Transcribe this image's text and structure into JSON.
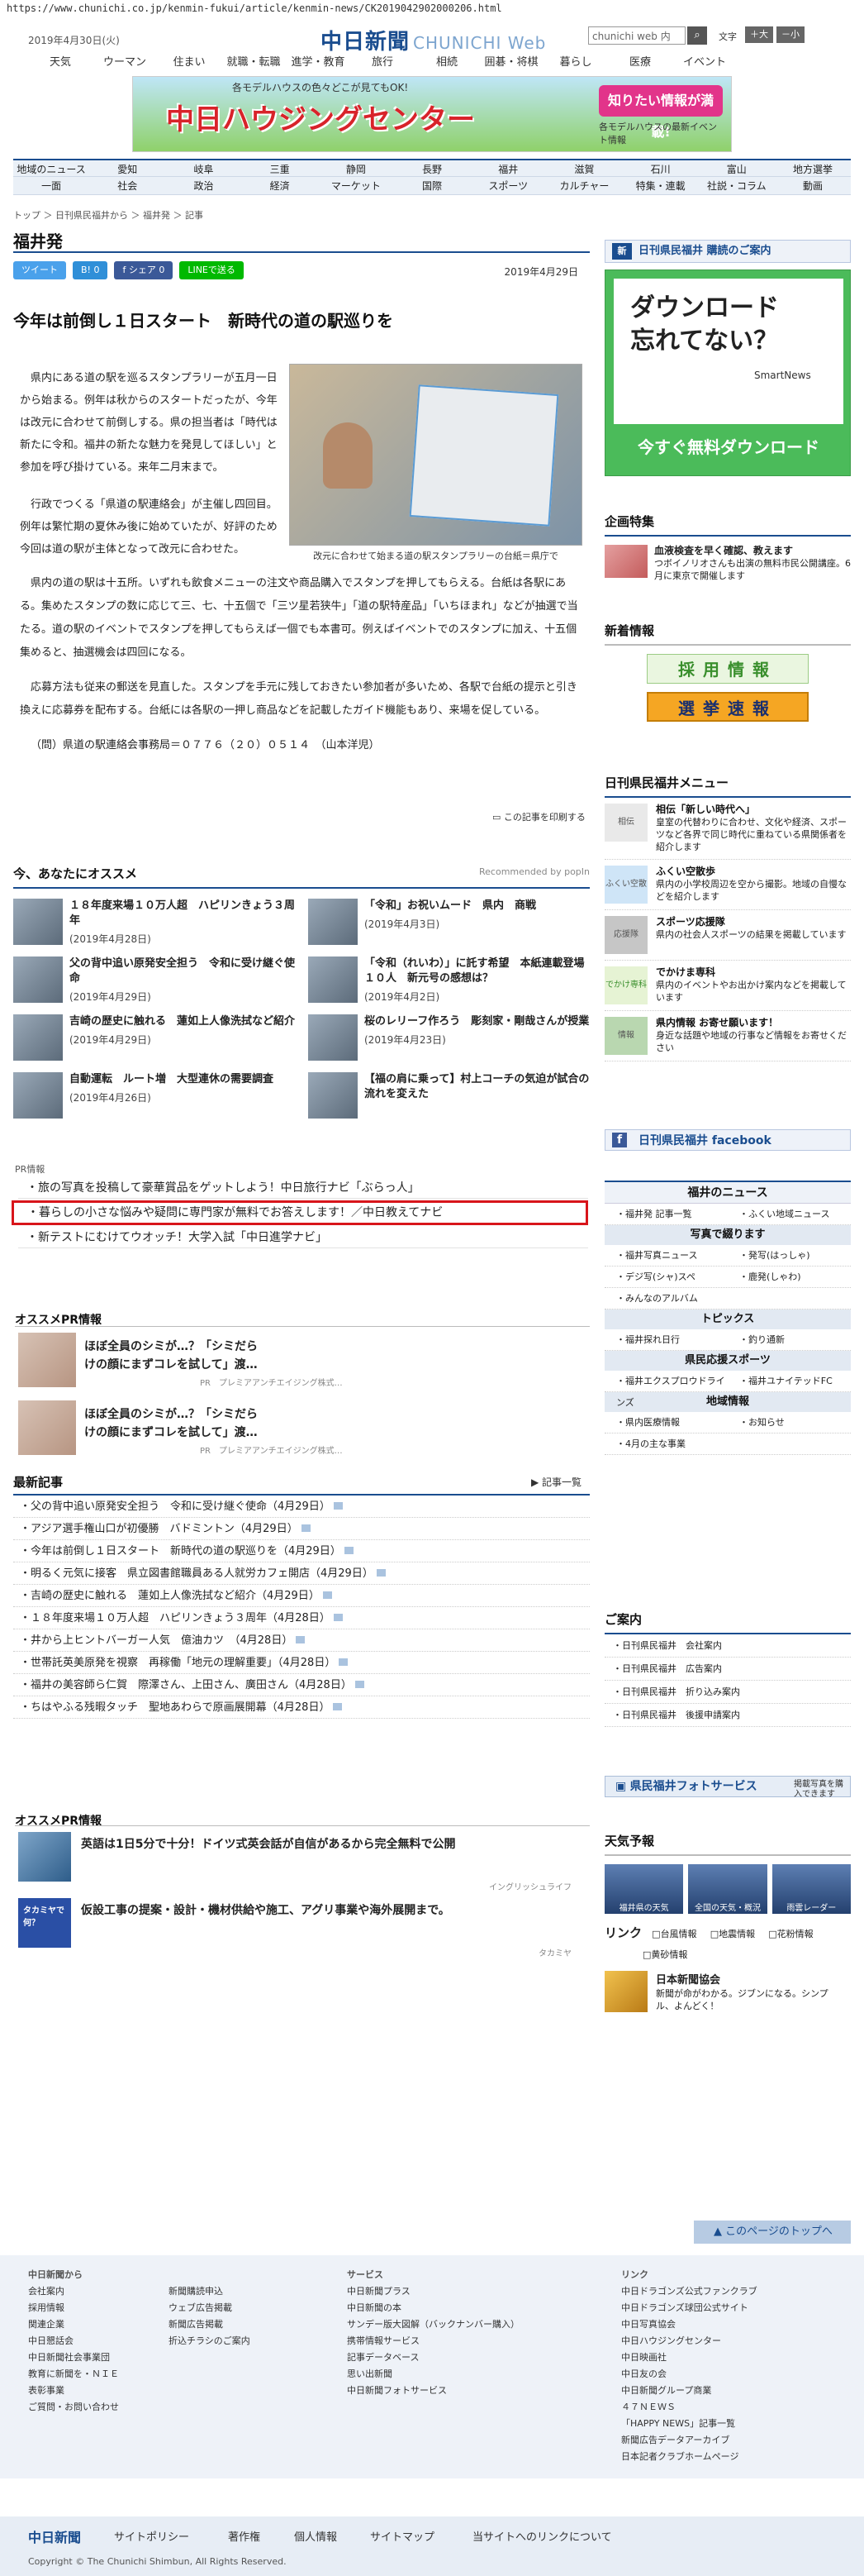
{
  "browser": {
    "url": "https://www.chunichi.co.jp/kenmin-fukui/article/kenmin-news/CK2019042902000206.html"
  },
  "header": {
    "date": "2019年4月30日(火)",
    "logo_main": "中日新聞",
    "logo_sub": "CHUNICHI Web",
    "search_placeholder": "chunichi web 内",
    "search_icon": "search-icon",
    "font_label": "文字",
    "font_large": "＋大",
    "font_small": "－小"
  },
  "main_nav": [
    "天気",
    "ウーマン",
    "住まい",
    "就職・転職",
    "進学・教育",
    "旅行",
    "相続",
    "囲碁・将棋",
    "暮らし",
    "医療",
    "イベント"
  ],
  "banner": {
    "title": "中日ハウジングセンター",
    "sub": "各モデルハウスの色々どこが見てもOK!",
    "cta": "知りたい情報が満載!",
    "cta_sub": "各モデルハウスの最新イベント情報"
  },
  "region_nav": {
    "row1": [
      "地域のニュース",
      "愛知",
      "岐阜",
      "三重",
      "静岡",
      "長野",
      "福井",
      "滋賀",
      "石川",
      "富山",
      "地方選挙"
    ],
    "row2": [
      "一面",
      "社会",
      "政治",
      "経済",
      "マーケット",
      "国際",
      "スポーツ",
      "カルチャー",
      "特集・連載",
      "社説・コラム",
      "動画"
    ]
  },
  "breadcrumb": "トップ ＞ 日刊県民福井から ＞ 福井発 ＞ 記事",
  "section_title": "福井発",
  "share": {
    "tweet": "ツイート",
    "hatena": "B! 0",
    "fb_share": "f シェア 0",
    "line": "LINEで送る"
  },
  "article": {
    "date": "2019年4月29日",
    "headline": "今年は前倒し１日スタート　新時代の道の駅巡りを",
    "photo_caption": "改元に合わせて始まる道の駅スタンプラリーの台紙＝県庁で",
    "p1": "県内にある道の駅を巡るスタンプラリーが五月一日から始まる。例年は秋からのスタートだったが、今年は改元に合わせて前倒しする。県の担当者は「時代は新たに令和。福井の新たな魅力を発見してほしい」と参加を呼び掛けている。来年二月末まで。",
    "p2": "行政でつくる「県道の駅連絡会」が主催し四回目。例年は繁忙期の夏休み後に始めていたが、好評のため今回は道の駅が主体となって改元に合わせた。",
    "p3": "県内の道の駅は十五所。いずれも飲食メニューの注文や商品購入でスタンプを押してもらえる。台紙は各駅にある。集めたスタンプの数に応じて三、七、十五個で「三ツ星若狭牛」「道の駅特産品」「いちほまれ」などが抽選で当たる。道の駅のイベントでスタンプを押してもらえば一個でも本書可。例えばイベントでのスタンプに加え、十五個集めると、抽選機会は四回になる。",
    "p4": "応募方法も従来の郵送を見直した。スタンプを手元に残しておきたい参加者が多いため、各駅で台紙の提示と引き換えに応募券を配布する。台紙には各駅の一押し商品などを記載したガイド機能もあり、来場を促している。",
    "p5": "（問）県道の駅連絡会事務局＝０７７６（２０）０５１４　（山本洋児）",
    "print": "この記事を印刷する"
  },
  "recommend": {
    "title": "今、あなたにオススメ",
    "by": "Recommended by popIn",
    "items": [
      {
        "title": "１８年度来場１０万人超　ハピリンきょう３周年",
        "date": "(2019年4月28日)"
      },
      {
        "title": "「令和」お祝いムード　県内　商戦",
        "date": "(2019年4月3日)"
      },
      {
        "title": "父の背中追い原発安全担う　令和に受け継ぐ使命",
        "date": "(2019年4月29日)"
      },
      {
        "title": "「令和（れいわ）」に託す希望　本紙連載登場１０人　新元号の感想は？",
        "date": "(2019年4月2日)"
      },
      {
        "title": "吉崎の歴史に触れる　蓮如上人像洗拭など紹介",
        "date": "(2019年4月29日)"
      },
      {
        "title": "桜のレリーフ作ろう　彫刻家・剛哉さんが授業",
        "date": "(2019年4月23日)"
      },
      {
        "title": "自動運転　ルート増　大型連休の需要調査",
        "date": "(2019年4月26日)"
      },
      {
        "title": "【福の肩に乗って】村上コーチの気迫が試合の流れを変えた",
        "date": ""
      }
    ]
  },
  "pr": {
    "label": "PR情報",
    "items": [
      "旅の写真を投稿して豪華賞品をゲットしよう！中日旅行ナビ「ぶらっ人」",
      "暮らしの小さな悩みや疑問に専門家が無料でお答えします！／中日教えてナビ",
      "新テストにむけてウオッチ！大学入試「中日進学ナビ」"
    ]
  },
  "osusume_pr": {
    "title": "オススメPR情報",
    "items": [
      {
        "title": "ほぼ全員のシミが…？「シミだらけの顔にまずコレを試して」渡…",
        "sponsor": "PR　プレミアアンチエイジング株式…"
      },
      {
        "title": "ほぼ全員のシミが…？「シミだらけの顔にまずコレを試して」渡…",
        "sponsor": "PR　プレミアアンチエイジング株式…"
      }
    ]
  },
  "latest": {
    "title": "最新記事",
    "more": "記事一覧",
    "items": [
      "父の背中追い原発安全担う　令和に受け継ぐ使命（4月29日）",
      "アジア選手権山口が初優勝　バドミントン（4月29日）",
      "今年は前倒し１日スタート　新時代の道の駅巡りを（4月29日）",
      "明るく元気に接客　県立図書館職員ある人就労カフェ開店（4月29日）",
      "吉崎の歴史に触れる　蓮如上人像洗拭など紹介（4月29日）",
      "１８年度来場１０万人超　ハピリンきょう３周年（4月28日）",
      "井から上ヒントバーガー人気　億油カツ　（4月28日）",
      "世帯託英美原発を視察　再稼働「地元の理解重要」（4月28日）",
      "福井の美容師ら仁賀　際澤さん、上田さん、廣田さん（4月28日）",
      "ちはやふる残暇タッチ　聖地あわらで原画展開幕（4月28日）"
    ]
  },
  "osusume_pr2": {
    "title": "オススメPR情報",
    "items": [
      {
        "title": "英語は1日5分で十分！ドイツ式英会話が自信があるから完全無料で公開",
        "sponsor": "イングリッシュライフ"
      },
      {
        "title": "仮設工事の提案・設計・機材供給や施工、アグリ事業や海外展開まで。",
        "sponsor": "タカミヤ",
        "logo": "タカミヤで何？"
      }
    ]
  },
  "sidebar": {
    "kenmin_head": "日刊県民福井 購読のご案内",
    "dl_ad": {
      "line1": "ダウンロード",
      "line2": "忘れてない？",
      "brand": "SmartNews",
      "cta": "今すぐ無料ダウンロード"
    },
    "kikaku": {
      "title": "企画特集",
      "item_title": "血液検査を早く確認、教えます",
      "item_text": "つボイノリオさんも出演の無料市民公開講座。6月に東京で開催します"
    },
    "chaku": {
      "title": "新着情報",
      "b1": "採用情報",
      "b2": "選挙速報"
    },
    "menu": {
      "title": "日刊県民福井メニュー",
      "items": [
        {
          "thumb": "相伝",
          "title": "相伝「新しい時代へ」",
          "text": "皇室の代替わりに合わせ、文化や経済、スポーツなど各界で同じ時代に重ねている県関係者を紹介します"
        },
        {
          "thumb": "ふくい空散歩",
          "title": "ふくい空散歩",
          "text": "県内の小学校周辺を空から撮影。地域の自慢などを紹介します"
        },
        {
          "thumb": "応援隊",
          "title": "スポーツ応援隊",
          "text": "県内の社会人スポーツの結果を掲載しています"
        },
        {
          "thumb": "でかけ専科",
          "title": "でかけま専科",
          "text": "県内のイベントやお出かけ案内などを掲載しています"
        },
        {
          "thumb": "情報",
          "title": "県内情報 お寄せ願います！",
          "text": "身近な話題や地域の行事など情報をお寄せください"
        }
      ]
    },
    "facebook": "日刊県民福井 facebook",
    "fukui_news": {
      "title": "福井のニュース",
      "r1": [
        "福井発 記事一覧",
        "ふくい地域ニュース"
      ],
      "photo_head": "写真で綴ります",
      "r2": [
        "福井写真ニュース",
        "発写(はっしゃ)"
      ],
      "r3": [
        "デジ写(シャ)スペ",
        "鹿発(しゃわ)"
      ],
      "r4": [
        "みんなのアルバム"
      ],
      "topics_head": "トピックス",
      "r5": [
        "福井探れ日行",
        "釣り通新"
      ],
      "sports_head": "県民応援スポーツ",
      "r6": [
        "福井エクスプロウドラインズ",
        "福井ユナイテッドFC"
      ],
      "local_head": "地域情報",
      "r7": [
        "県内医療情報",
        "お知らせ"
      ],
      "r8": [
        "4月の主な事業"
      ]
    },
    "annai": {
      "title": "ご案内",
      "items": [
        "日刊県民福井　会社案内",
        "日刊県民福井　広告案内",
        "日刊県民福井　折り込み案内",
        "日刊県民福井　後援申請案内"
      ]
    },
    "photo_service": {
      "title": "県民福井フォトサービス",
      "sub": "掲載写真を購入できます"
    },
    "weather": {
      "title": "天気予報",
      "items": [
        "福井県の天気",
        "全国の天気・概況",
        "雨雲レーダー"
      ]
    },
    "link": {
      "title": "リンク",
      "items": [
        "台風情報",
        "地震情報",
        "花粉情報",
        "黄砂情報"
      ]
    },
    "chunichi_kai": {
      "title": "日本新聞協会",
      "text": "新聞が命がわかる。ジブンになる。シンプル、よんどく！"
    }
  },
  "footer": {
    "to_top": "このページのトップへ",
    "col1_head": "中日新聞から",
    "col1": [
      "会社案内",
      "採用情報",
      "関連企業",
      "中日懇話会",
      "中日新聞社会事業団",
      "教育に新聞を・ＮＩＥ",
      "表彰事業",
      "ご質問・お問い合わせ"
    ],
    "col2": [
      "新聞購読申込",
      "ウェブ広告掲載",
      "新聞広告掲載",
      "折込チラシのご案内"
    ],
    "col3_head": "サービス",
    "col3": [
      "中日新聞プラス",
      "中日新聞の本",
      "サンデー版大図解（バックナンバー購入）",
      "携帯情報サービス",
      "記事データベース",
      "思い出新聞",
      "中日新聞フォトサービス"
    ],
    "col4_head": "リンク",
    "col4": [
      "中日ドラゴンズ公式ファンクラブ",
      "中日ドラゴンズ球団公式サイト",
      "中日写真協会",
      "中日ハウジングセンター",
      "中日映画社",
      "中日友の会",
      "中日新聞グループ商業",
      "４７ＮＥＷＳ",
      "「HAPPY NEWS」記事一覧",
      "新聞広告データアーカイブ",
      "日本記者クラブホームページ"
    ],
    "bar_logo": "中日新聞",
    "bar_nav": [
      "サイトポリシー",
      "著作権",
      "個人情報",
      "サイトマップ",
      "当サイトへのリンクについて"
    ],
    "copyright": "Copyright © The Chunichi Shimbun, All Rights Reserved."
  }
}
